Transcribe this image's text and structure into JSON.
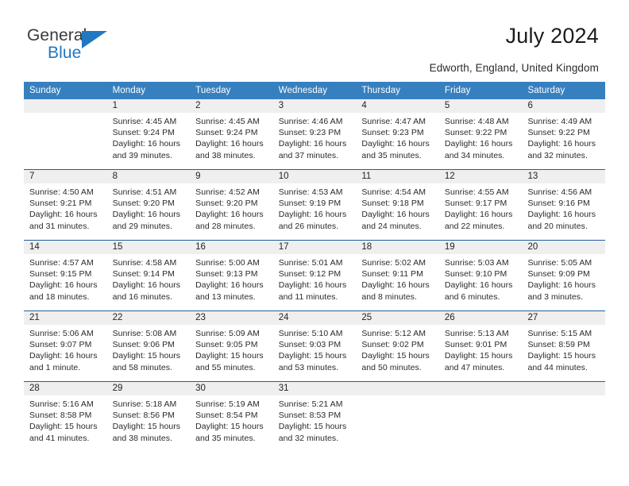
{
  "brand": {
    "name_part1": "General",
    "name_part2": "Blue",
    "logo_icon": "triangle-logo-icon"
  },
  "header": {
    "title": "July 2024",
    "subtitle": "Edworth, England, United Kingdom"
  },
  "calendar": {
    "weekdays": [
      "Sunday",
      "Monday",
      "Tuesday",
      "Wednesday",
      "Thursday",
      "Friday",
      "Saturday"
    ],
    "colors": {
      "header_blue": "#3780bf",
      "separator_blue": "#1f5fa0",
      "number_band_gray": "#efefef",
      "brand_blue": "#1f78c1"
    },
    "weeks": [
      [
        {
          "day": "",
          "lines": []
        },
        {
          "day": "1",
          "lines": [
            "Sunrise: 4:45 AM",
            "Sunset: 9:24 PM",
            "Daylight: 16 hours",
            "and 39 minutes."
          ]
        },
        {
          "day": "2",
          "lines": [
            "Sunrise: 4:45 AM",
            "Sunset: 9:24 PM",
            "Daylight: 16 hours",
            "and 38 minutes."
          ]
        },
        {
          "day": "3",
          "lines": [
            "Sunrise: 4:46 AM",
            "Sunset: 9:23 PM",
            "Daylight: 16 hours",
            "and 37 minutes."
          ]
        },
        {
          "day": "4",
          "lines": [
            "Sunrise: 4:47 AM",
            "Sunset: 9:23 PM",
            "Daylight: 16 hours",
            "and 35 minutes."
          ]
        },
        {
          "day": "5",
          "lines": [
            "Sunrise: 4:48 AM",
            "Sunset: 9:22 PM",
            "Daylight: 16 hours",
            "and 34 minutes."
          ]
        },
        {
          "day": "6",
          "lines": [
            "Sunrise: 4:49 AM",
            "Sunset: 9:22 PM",
            "Daylight: 16 hours",
            "and 32 minutes."
          ]
        }
      ],
      [
        {
          "day": "7",
          "lines": [
            "Sunrise: 4:50 AM",
            "Sunset: 9:21 PM",
            "Daylight: 16 hours",
            "and 31 minutes."
          ]
        },
        {
          "day": "8",
          "lines": [
            "Sunrise: 4:51 AM",
            "Sunset: 9:20 PM",
            "Daylight: 16 hours",
            "and 29 minutes."
          ]
        },
        {
          "day": "9",
          "lines": [
            "Sunrise: 4:52 AM",
            "Sunset: 9:20 PM",
            "Daylight: 16 hours",
            "and 28 minutes."
          ]
        },
        {
          "day": "10",
          "lines": [
            "Sunrise: 4:53 AM",
            "Sunset: 9:19 PM",
            "Daylight: 16 hours",
            "and 26 minutes."
          ]
        },
        {
          "day": "11",
          "lines": [
            "Sunrise: 4:54 AM",
            "Sunset: 9:18 PM",
            "Daylight: 16 hours",
            "and 24 minutes."
          ]
        },
        {
          "day": "12",
          "lines": [
            "Sunrise: 4:55 AM",
            "Sunset: 9:17 PM",
            "Daylight: 16 hours",
            "and 22 minutes."
          ]
        },
        {
          "day": "13",
          "lines": [
            "Sunrise: 4:56 AM",
            "Sunset: 9:16 PM",
            "Daylight: 16 hours",
            "and 20 minutes."
          ]
        }
      ],
      [
        {
          "day": "14",
          "lines": [
            "Sunrise: 4:57 AM",
            "Sunset: 9:15 PM",
            "Daylight: 16 hours",
            "and 18 minutes."
          ]
        },
        {
          "day": "15",
          "lines": [
            "Sunrise: 4:58 AM",
            "Sunset: 9:14 PM",
            "Daylight: 16 hours",
            "and 16 minutes."
          ]
        },
        {
          "day": "16",
          "lines": [
            "Sunrise: 5:00 AM",
            "Sunset: 9:13 PM",
            "Daylight: 16 hours",
            "and 13 minutes."
          ]
        },
        {
          "day": "17",
          "lines": [
            "Sunrise: 5:01 AM",
            "Sunset: 9:12 PM",
            "Daylight: 16 hours",
            "and 11 minutes."
          ]
        },
        {
          "day": "18",
          "lines": [
            "Sunrise: 5:02 AM",
            "Sunset: 9:11 PM",
            "Daylight: 16 hours",
            "and 8 minutes."
          ]
        },
        {
          "day": "19",
          "lines": [
            "Sunrise: 5:03 AM",
            "Sunset: 9:10 PM",
            "Daylight: 16 hours",
            "and 6 minutes."
          ]
        },
        {
          "day": "20",
          "lines": [
            "Sunrise: 5:05 AM",
            "Sunset: 9:09 PM",
            "Daylight: 16 hours",
            "and 3 minutes."
          ]
        }
      ],
      [
        {
          "day": "21",
          "lines": [
            "Sunrise: 5:06 AM",
            "Sunset: 9:07 PM",
            "Daylight: 16 hours",
            "and 1 minute."
          ]
        },
        {
          "day": "22",
          "lines": [
            "Sunrise: 5:08 AM",
            "Sunset: 9:06 PM",
            "Daylight: 15 hours",
            "and 58 minutes."
          ]
        },
        {
          "day": "23",
          "lines": [
            "Sunrise: 5:09 AM",
            "Sunset: 9:05 PM",
            "Daylight: 15 hours",
            "and 55 minutes."
          ]
        },
        {
          "day": "24",
          "lines": [
            "Sunrise: 5:10 AM",
            "Sunset: 9:03 PM",
            "Daylight: 15 hours",
            "and 53 minutes."
          ]
        },
        {
          "day": "25",
          "lines": [
            "Sunrise: 5:12 AM",
            "Sunset: 9:02 PM",
            "Daylight: 15 hours",
            "and 50 minutes."
          ]
        },
        {
          "day": "26",
          "lines": [
            "Sunrise: 5:13 AM",
            "Sunset: 9:01 PM",
            "Daylight: 15 hours",
            "and 47 minutes."
          ]
        },
        {
          "day": "27",
          "lines": [
            "Sunrise: 5:15 AM",
            "Sunset: 8:59 PM",
            "Daylight: 15 hours",
            "and 44 minutes."
          ]
        }
      ],
      [
        {
          "day": "28",
          "lines": [
            "Sunrise: 5:16 AM",
            "Sunset: 8:58 PM",
            "Daylight: 15 hours",
            "and 41 minutes."
          ]
        },
        {
          "day": "29",
          "lines": [
            "Sunrise: 5:18 AM",
            "Sunset: 8:56 PM",
            "Daylight: 15 hours",
            "and 38 minutes."
          ]
        },
        {
          "day": "30",
          "lines": [
            "Sunrise: 5:19 AM",
            "Sunset: 8:54 PM",
            "Daylight: 15 hours",
            "and 35 minutes."
          ]
        },
        {
          "day": "31",
          "lines": [
            "Sunrise: 5:21 AM",
            "Sunset: 8:53 PM",
            "Daylight: 15 hours",
            "and 32 minutes."
          ]
        },
        {
          "day": "",
          "lines": []
        },
        {
          "day": "",
          "lines": []
        },
        {
          "day": "",
          "lines": []
        }
      ]
    ]
  }
}
